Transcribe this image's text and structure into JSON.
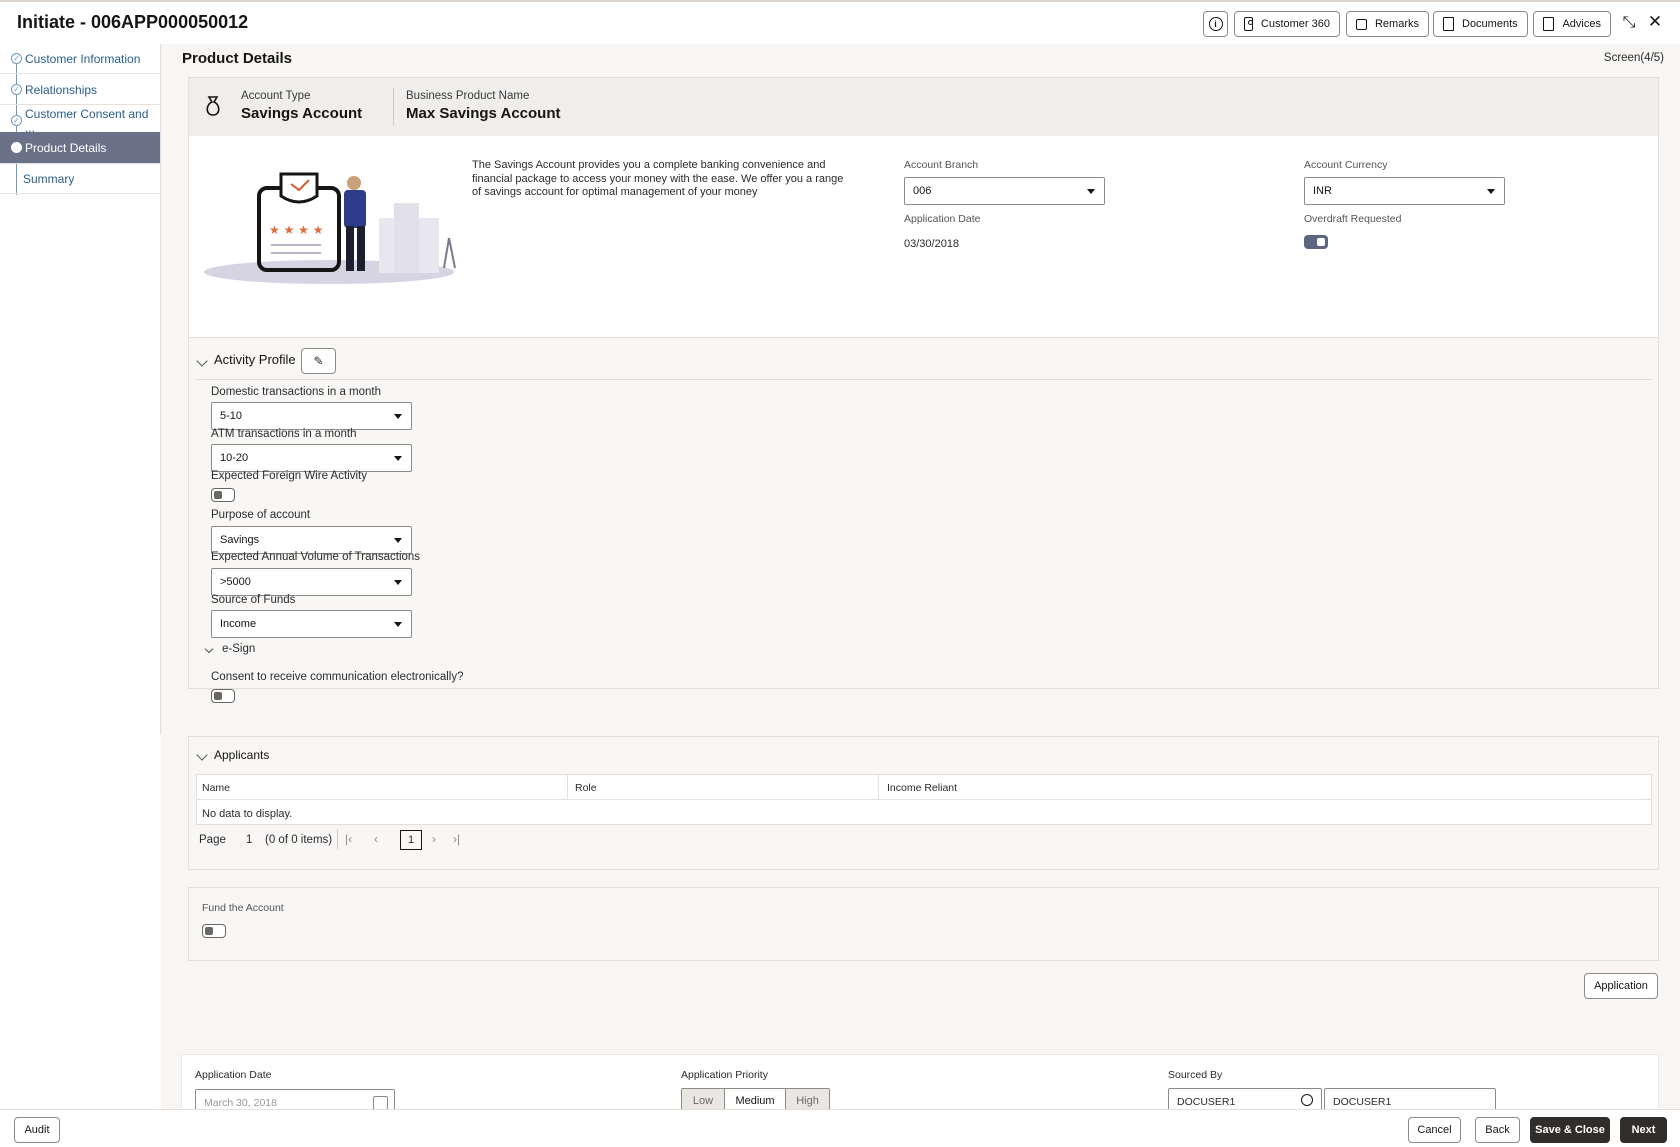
{
  "header": {
    "title": "Initiate - 006APP000050012",
    "buttons": {
      "info": "i",
      "customer360": "Customer 360",
      "remarks": "Remarks",
      "documents": "Documents",
      "advices": "Advices"
    }
  },
  "sidebar": {
    "items": [
      {
        "label": "Customer Information",
        "state": "done"
      },
      {
        "label": "Relationships",
        "state": "done"
      },
      {
        "label": "Customer Consent and ...",
        "state": "done"
      },
      {
        "label": "Product Details",
        "state": "active"
      },
      {
        "label": "Summary",
        "state": "pending"
      }
    ]
  },
  "page": {
    "title": "Product Details",
    "screen": "Screen(4/5)"
  },
  "product": {
    "account_type_label": "Account Type",
    "account_type": "Savings Account",
    "business_product_label": "Business Product Name",
    "business_product": "Max Savings Account",
    "description": "The Savings Account provides you a complete banking convenience and financial package to access your money with the ease. We offer you a range of savings account for optimal management of your money",
    "account_branch_label": "Account Branch",
    "account_branch": "006",
    "account_currency_label": "Account Currency",
    "account_currency": "INR",
    "application_date_label": "Application Date",
    "application_date": "03/30/2018",
    "overdraft_label": "Overdraft Requested",
    "overdraft_on": true
  },
  "activity": {
    "title": "Activity Profile",
    "domestic_label": "Domestic transactions in a month",
    "domestic_value": "5-10",
    "atm_label": "ATM transactions in a month",
    "atm_value": "10-20",
    "foreign_wire_label": "Expected Foreign Wire Activity",
    "purpose_label": "Purpose of account",
    "purpose_value": "Savings",
    "annual_volume_label": "Expected Annual Volume of Transactions",
    "annual_volume_value": ">5000",
    "source_funds_label": "Source of Funds",
    "source_funds_value": "Income",
    "esign_title": "e-Sign",
    "consent_label": "Consent to receive communication electronically?"
  },
  "applicants": {
    "title": "Applicants",
    "columns": [
      "Name",
      "Role",
      "Income Reliant"
    ],
    "empty_text": "No data to display.",
    "page_label": "Page",
    "page_number": "1",
    "items_text": "(0 of 0 items)",
    "current_page": "1"
  },
  "fund": {
    "label": "Fund the Account"
  },
  "application_button": "Application",
  "footer_form": {
    "app_date_label": "Application Date",
    "app_date_value": "March 30, 2018",
    "priority_label": "Application Priority",
    "priority_options": [
      "Low",
      "Medium",
      "High"
    ],
    "priority_selected": "Medium",
    "sourced_by_label": "Sourced By",
    "sourced_by_value": "DOCUSER1",
    "sourced_by_name": "DOCUSER1"
  },
  "footer": {
    "audit": "Audit",
    "cancel": "Cancel",
    "back": "Back",
    "save_close": "Save & Close",
    "next": "Next"
  }
}
